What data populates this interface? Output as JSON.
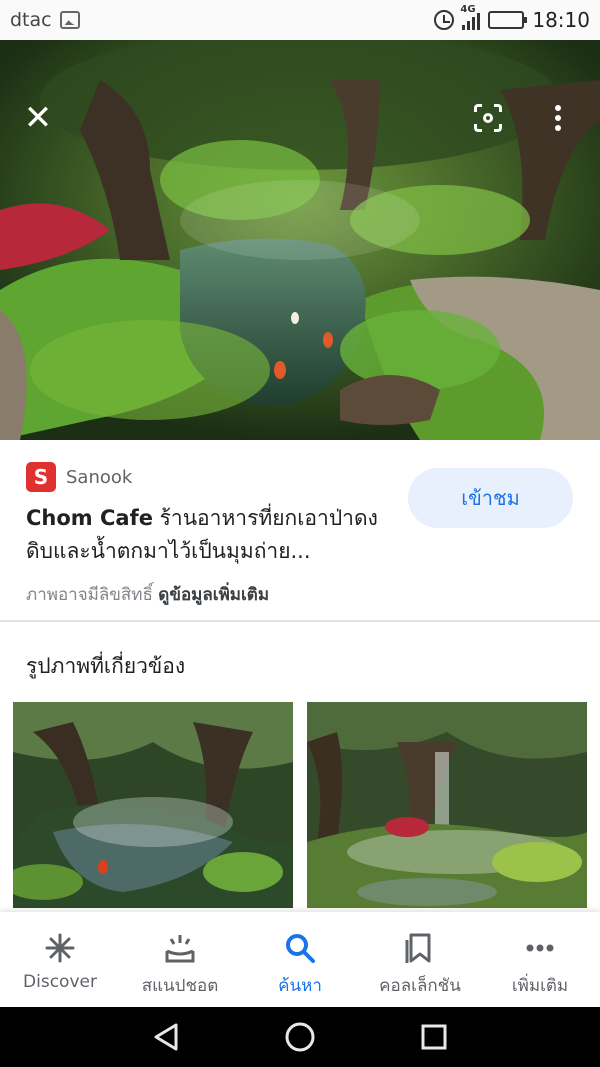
{
  "status_bar": {
    "carrier": "dtac",
    "network": "4G",
    "time": "18:10",
    "battery_level": 0.4
  },
  "viewer": {
    "close_icon": "close-icon",
    "lens_icon": "google-lens-icon",
    "menu_icon": "more-vert-icon"
  },
  "source": {
    "logo_letter": "S",
    "name": "Sanook",
    "title_bold": "Chom Cafe",
    "title_rest": " ร้านอาหารที่ยกเอาป่าดงดิบและน้ำตกมาไว้เป็นมุมถ่าย...",
    "visit_label": "เข้าชม",
    "copyright_text": "ภาพอาจมีลิขสิทธิ์ ",
    "more_info_link": "ดูข้อมูลเพิ่มเติม"
  },
  "related": {
    "heading": "รูปภาพที่เกี่ยวข้อง"
  },
  "bottom_nav": {
    "items": [
      {
        "label": "Discover",
        "icon": "asterisk-icon"
      },
      {
        "label": "สแนปชอต",
        "icon": "snapshot-icon"
      },
      {
        "label": "ค้นหา",
        "icon": "search-icon"
      },
      {
        "label": "คอลเล็กชัน",
        "icon": "collections-icon"
      },
      {
        "label": "เพิ่มเติม",
        "icon": "more-horiz-icon"
      }
    ],
    "active_index": 2
  },
  "colors": {
    "accent": "#1a73e8",
    "visit_bg": "#e8f0fe",
    "brand_red": "#e03131"
  }
}
